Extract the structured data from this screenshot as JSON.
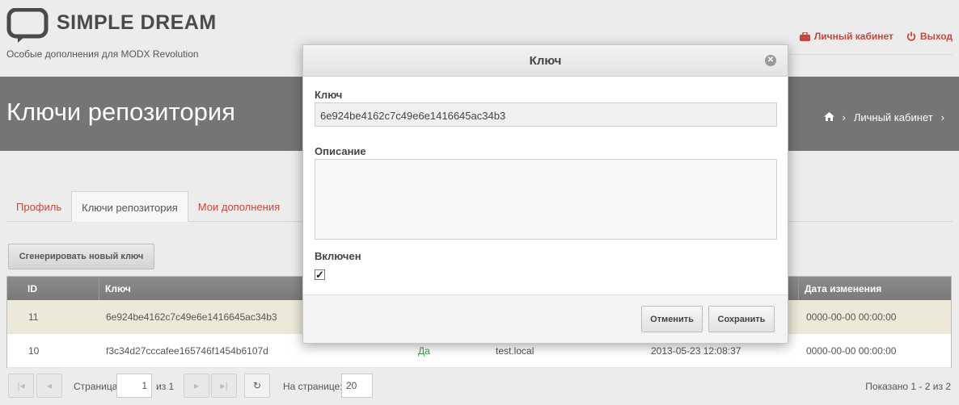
{
  "brand": {
    "name": "SIMPLE DREAM",
    "tagline": "Особые дополнения для MODX Revolution"
  },
  "top_links": {
    "cabinet": "Личный кабинет",
    "logout": "Выход"
  },
  "page": {
    "title": "Ключи репозитория",
    "breadcrumb": {
      "home_icon": "home-icon",
      "current": "Личный кабинет"
    }
  },
  "tabs": [
    {
      "label": "Профиль"
    },
    {
      "label": "Ключи репозитория"
    },
    {
      "label": "Мои дополнения"
    }
  ],
  "toolbar": {
    "generate_label": "Сгенерировать новый ключ"
  },
  "grid": {
    "columns": [
      "ID",
      "Ключ",
      "Дата изменения"
    ],
    "rows": [
      {
        "id": "11",
        "key": "6e924be4162c7c49e6e1416645ac34b3",
        "active": "",
        "host": "",
        "created": "",
        "modified": "0000-00-00 00:00:00"
      },
      {
        "id": "10",
        "key": "f3c34d27cccafee165746f1454b6107d",
        "active": "Да",
        "host": "test.local",
        "created": "2013-05-23 12:08:37",
        "modified": "0000-00-00 00:00:00"
      }
    ]
  },
  "pager": {
    "page_label": "Страница",
    "page_value": "1",
    "of_label": "из 1",
    "per_page_label": "На странице:",
    "per_page_value": "20",
    "summary": "Показано 1 - 2 из 2"
  },
  "modal": {
    "title": "Ключ",
    "key_label": "Ключ",
    "key_value": "6e924be4162c7c49e6e1416645ac34b3",
    "desc_label": "Описание",
    "desc_value": "",
    "enabled_label": "Включен",
    "enabled": true,
    "cancel_label": "Отменить",
    "save_label": "Сохранить"
  },
  "colors": {
    "accent": "#c9463d",
    "band": "#757575",
    "selected_row": "#ede9d8",
    "yes_green": "#3aa047"
  }
}
